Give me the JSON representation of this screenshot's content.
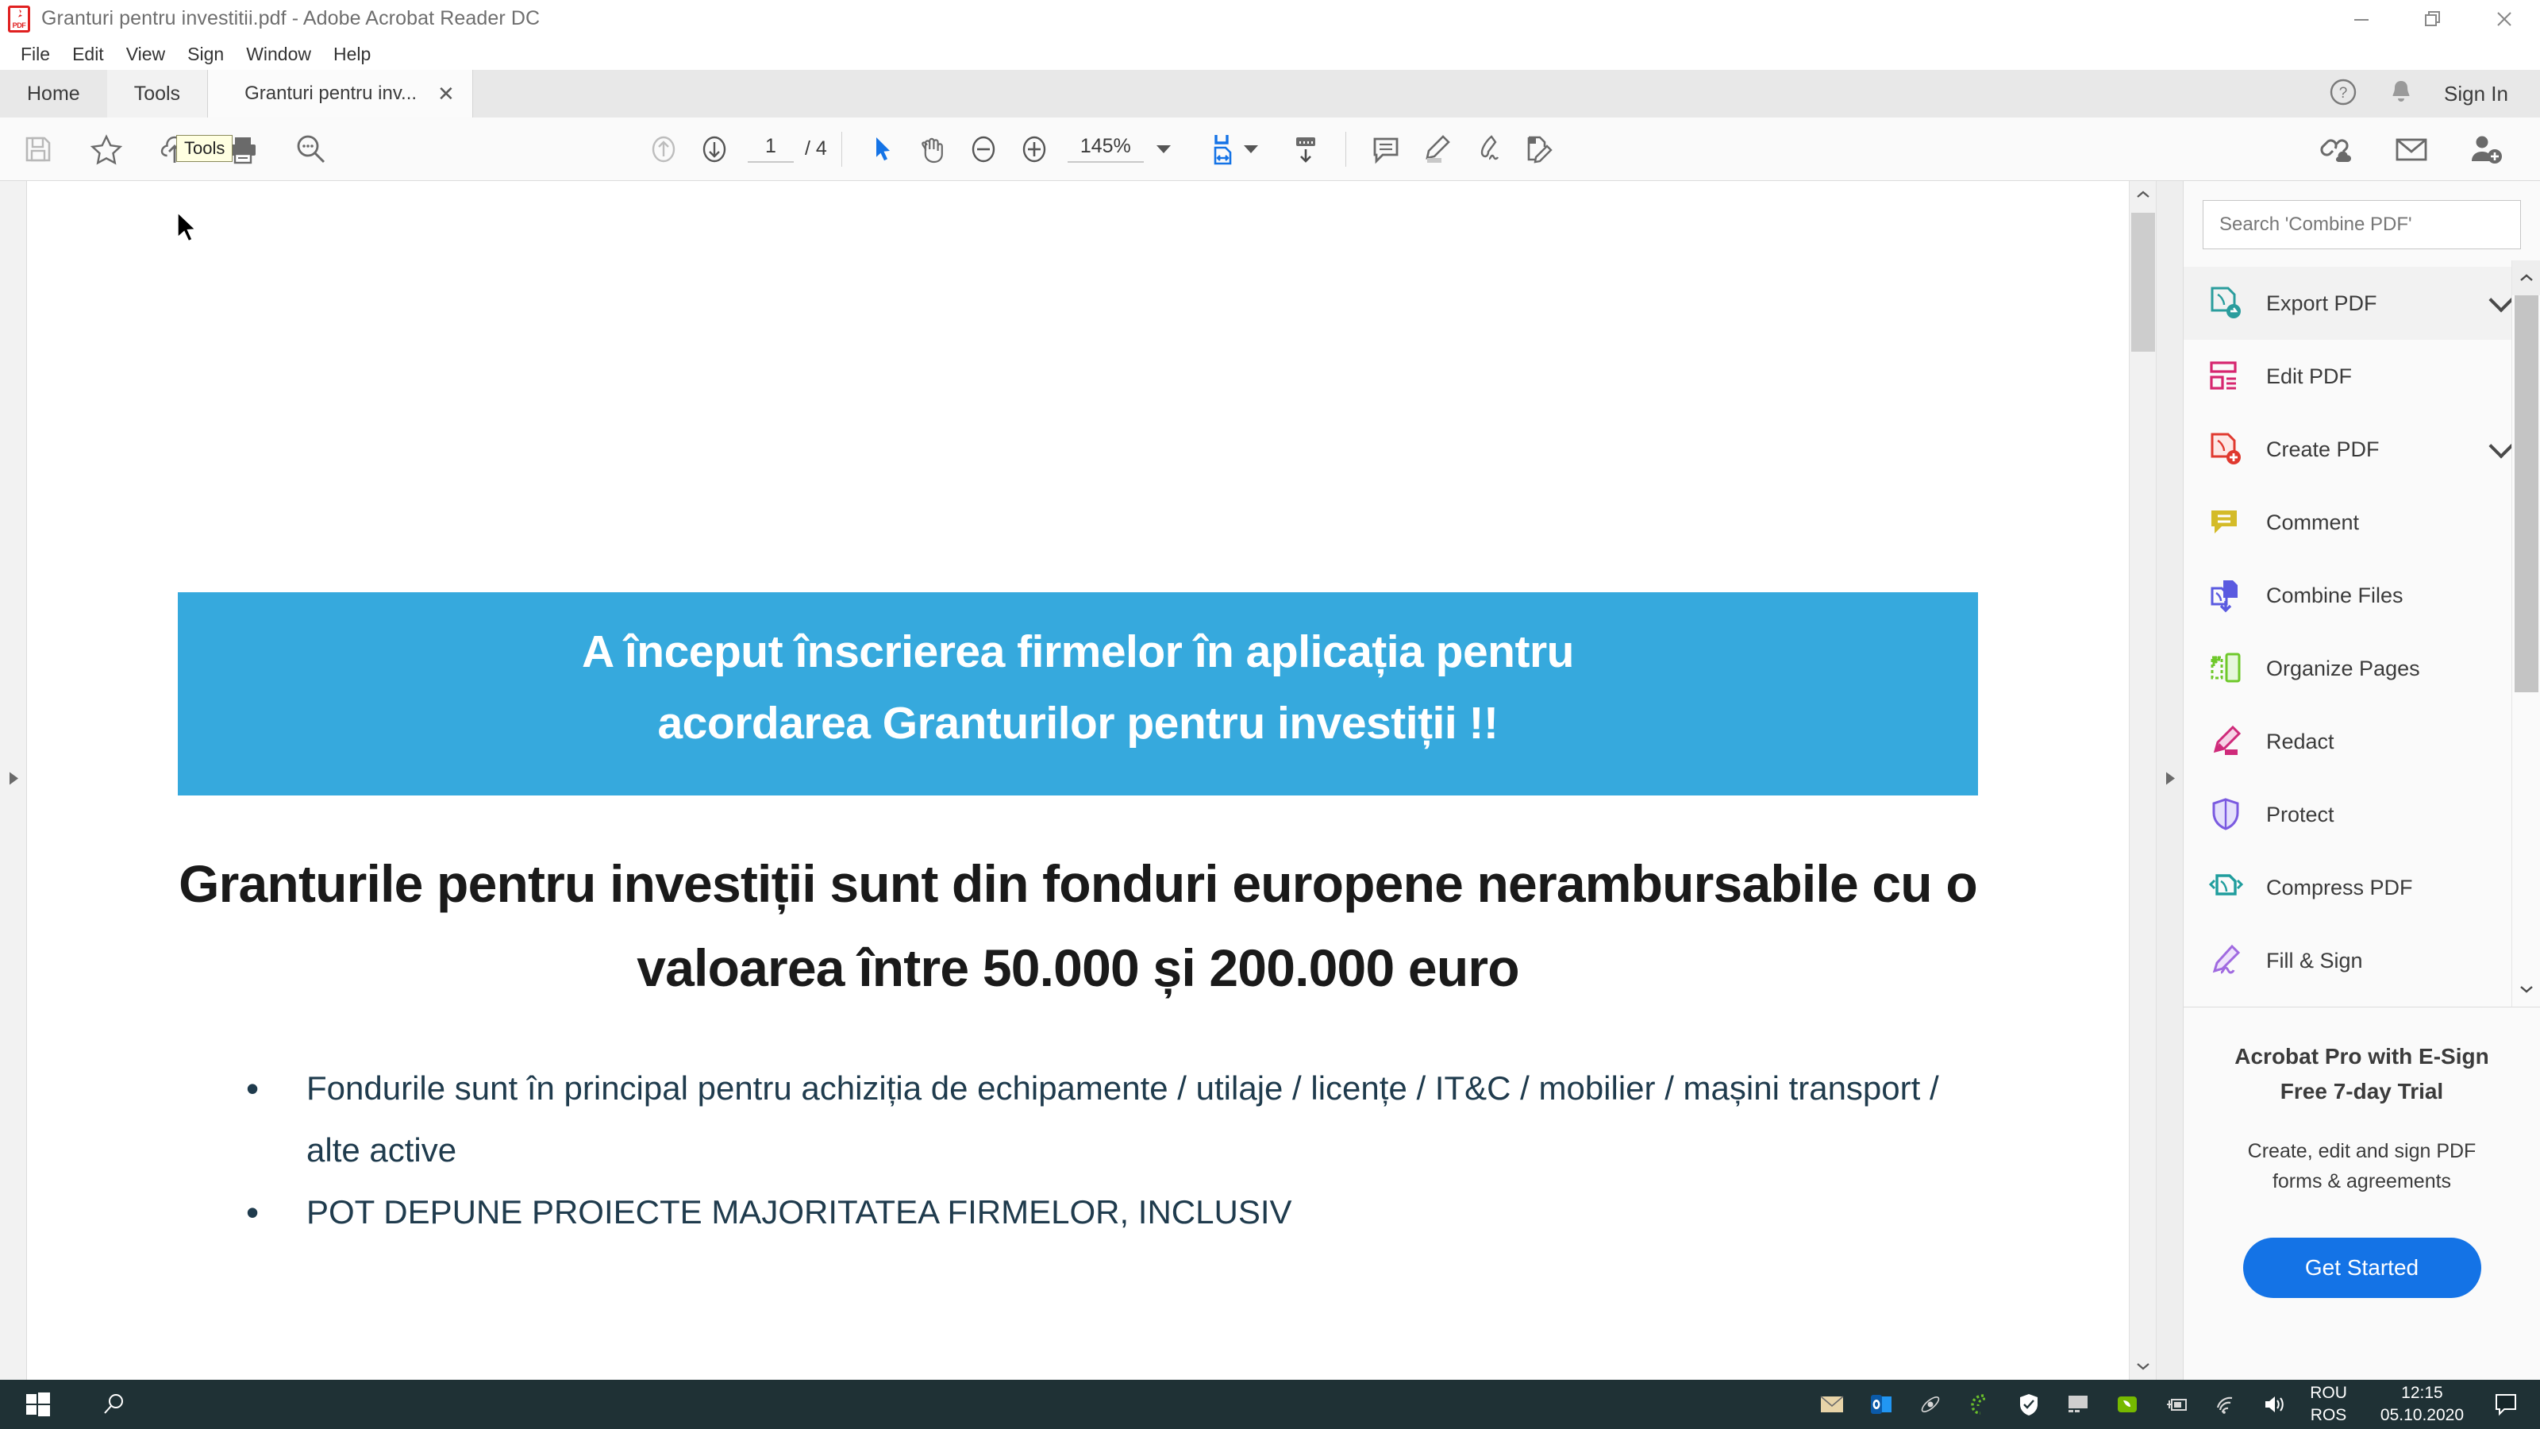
{
  "window": {
    "title": "Granturi pentru investitii.pdf - Adobe Acrobat Reader DC",
    "minimize": "–",
    "restore": "❐",
    "close": "✕"
  },
  "menubar": {
    "items": [
      "File",
      "Edit",
      "View",
      "Sign",
      "Window",
      "Help"
    ]
  },
  "tabstrip": {
    "home": "Home",
    "tools": "Tools",
    "doc_tab": "Granturi pentru inv...",
    "doc_tab_close": "✕",
    "sign_in": "Sign In"
  },
  "tooltip": {
    "text": "Tools"
  },
  "toolbar": {
    "page_current": "1",
    "page_total": "/ 4",
    "zoom_value": "145%"
  },
  "document": {
    "banner_lines": [
      "A început înscrierea firmelor în aplicația pentru",
      "acordarea Granturilor pentru investiții !!"
    ],
    "banner_color": "#36a9dd",
    "headline": "Granturile pentru investiții sunt din fonduri europene nerambursabile cu o valoarea între 50.000 și 200.000 euro",
    "bullets": [
      "Fondurile sunt în principal pentru achiziția de echipamente / utilaje / licențe / IT&C / mobilier / mașini transport / alte active",
      "POT DEPUNE PROIECTE MAJORITATEA FIRMELOR, INCLUSIV"
    ],
    "bullet_marker": "•"
  },
  "right_panel": {
    "search_placeholder": "Search 'Combine PDF'",
    "tools": [
      {
        "label": "Export PDF",
        "color": "#2a9d9d",
        "chevron": true,
        "highlight": true
      },
      {
        "label": "Edit PDF",
        "color": "#d6266f",
        "chevron": false,
        "highlight": false
      },
      {
        "label": "Create PDF",
        "color": "#e0392f",
        "chevron": true,
        "highlight": false
      },
      {
        "label": "Comment",
        "color": "#d4bb28",
        "chevron": false,
        "highlight": false
      },
      {
        "label": "Combine Files",
        "color": "#5a5ae0",
        "chevron": false,
        "highlight": false
      },
      {
        "label": "Organize Pages",
        "color": "#6ec82a",
        "chevron": false,
        "highlight": false
      },
      {
        "label": "Redact",
        "color": "#cf2a7a",
        "chevron": false,
        "highlight": false
      },
      {
        "label": "Protect",
        "color": "#7a5ae0",
        "chevron": false,
        "highlight": false
      },
      {
        "label": "Compress PDF",
        "color": "#1f9d9d",
        "chevron": false,
        "highlight": false
      },
      {
        "label": "Fill & Sign",
        "color": "#a06ae0",
        "chevron": false,
        "highlight": false
      }
    ],
    "promo": {
      "title_line1": "Acrobat Pro with E-Sign",
      "title_line2": "Free 7-day Trial",
      "sub_line1": "Create, edit and sign PDF",
      "sub_line2": "forms & agreements",
      "button": "Get Started",
      "button_color": "#1473e6"
    }
  },
  "taskbar": {
    "lang_line1": "ROU",
    "lang_line2": "ROS",
    "time": "12:15",
    "date": "05.10.2020"
  }
}
